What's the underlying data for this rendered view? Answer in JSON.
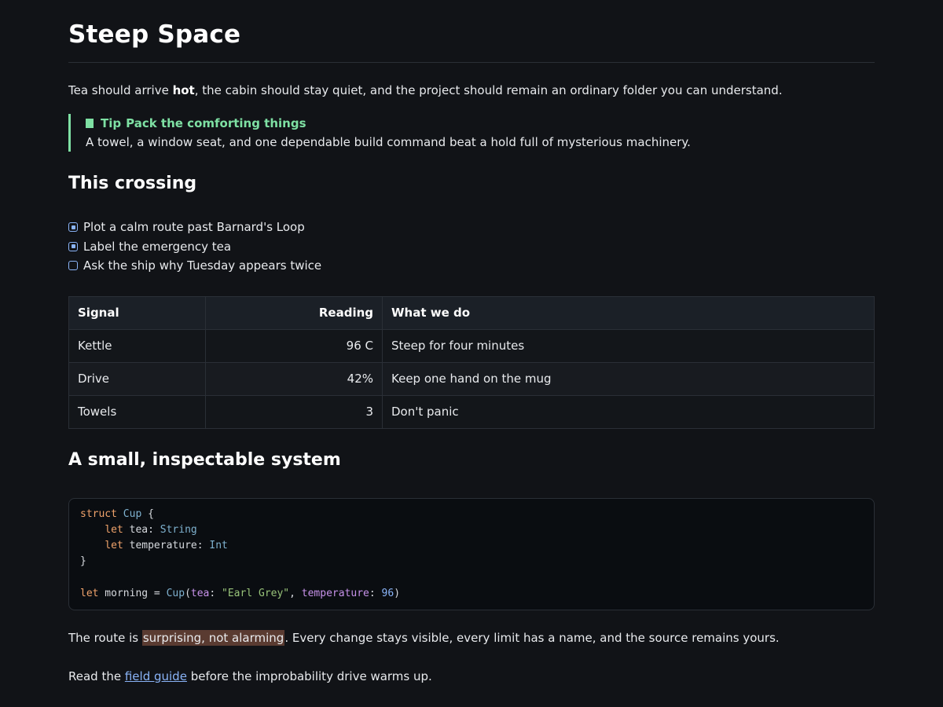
{
  "title": "Steep Space",
  "intro": {
    "before": "Tea should arrive ",
    "bold": "hot",
    "after": ", the cabin should stay quiet, and the project should remain an ordinary folder you can understand."
  },
  "tip": {
    "label": "Tip",
    "heading": "Pack the comforting things",
    "body": "A towel, a window seat, and one dependable build command beat a hold full of mysterious machinery.",
    "accent": "#7ee0a3"
  },
  "crossing": {
    "heading": "This crossing",
    "items": [
      {
        "text": "Plot a calm route past Barnard's Loop",
        "checked": true
      },
      {
        "text": "Label the emergency tea",
        "checked": true
      },
      {
        "text": "Ask the ship why Tuesday appears twice",
        "checked": false
      }
    ]
  },
  "table": {
    "headers": [
      "Signal",
      "Reading",
      "What we do"
    ],
    "rows": [
      [
        "Kettle",
        "96 C",
        "Steep for four minutes"
      ],
      [
        "Drive",
        "42%",
        "Keep one hand on the mug"
      ],
      [
        "Towels",
        "3",
        "Don't panic"
      ]
    ]
  },
  "system": {
    "heading": "A small, inspectable system",
    "code": {
      "line1": {
        "kw": "struct",
        "type": "Cup",
        "rest": " {"
      },
      "line2": {
        "kw": "let",
        "name": " tea: ",
        "type": "String"
      },
      "line3": {
        "kw": "let",
        "name": " temperature: ",
        "type": "Int"
      },
      "line4": "}",
      "line6": {
        "kw": "let",
        "name": " morning = ",
        "type": "Cup",
        "open": "(",
        "label1": "tea",
        "sep1": ": ",
        "str": "\"Earl Grey\"",
        "comma": ", ",
        "label2": "temperature",
        "sep2": ": ",
        "num": "96",
        "close": ")"
      }
    }
  },
  "route": {
    "before": "The route is ",
    "highlight": "surprising, not alarming",
    "after": ". Every change stays visible, every limit has a name, and the source remains yours."
  },
  "read": {
    "before": "Read the ",
    "link": "field guide",
    "after": " before the improbability drive warms up."
  },
  "colors": {
    "background": "#111317",
    "link": "#8ab4f8",
    "highlight": "#5a3b31"
  },
  "icons": {
    "tip": "bookmark-icon",
    "checked": "checked-box-icon",
    "unchecked": "unchecked-box-icon"
  }
}
